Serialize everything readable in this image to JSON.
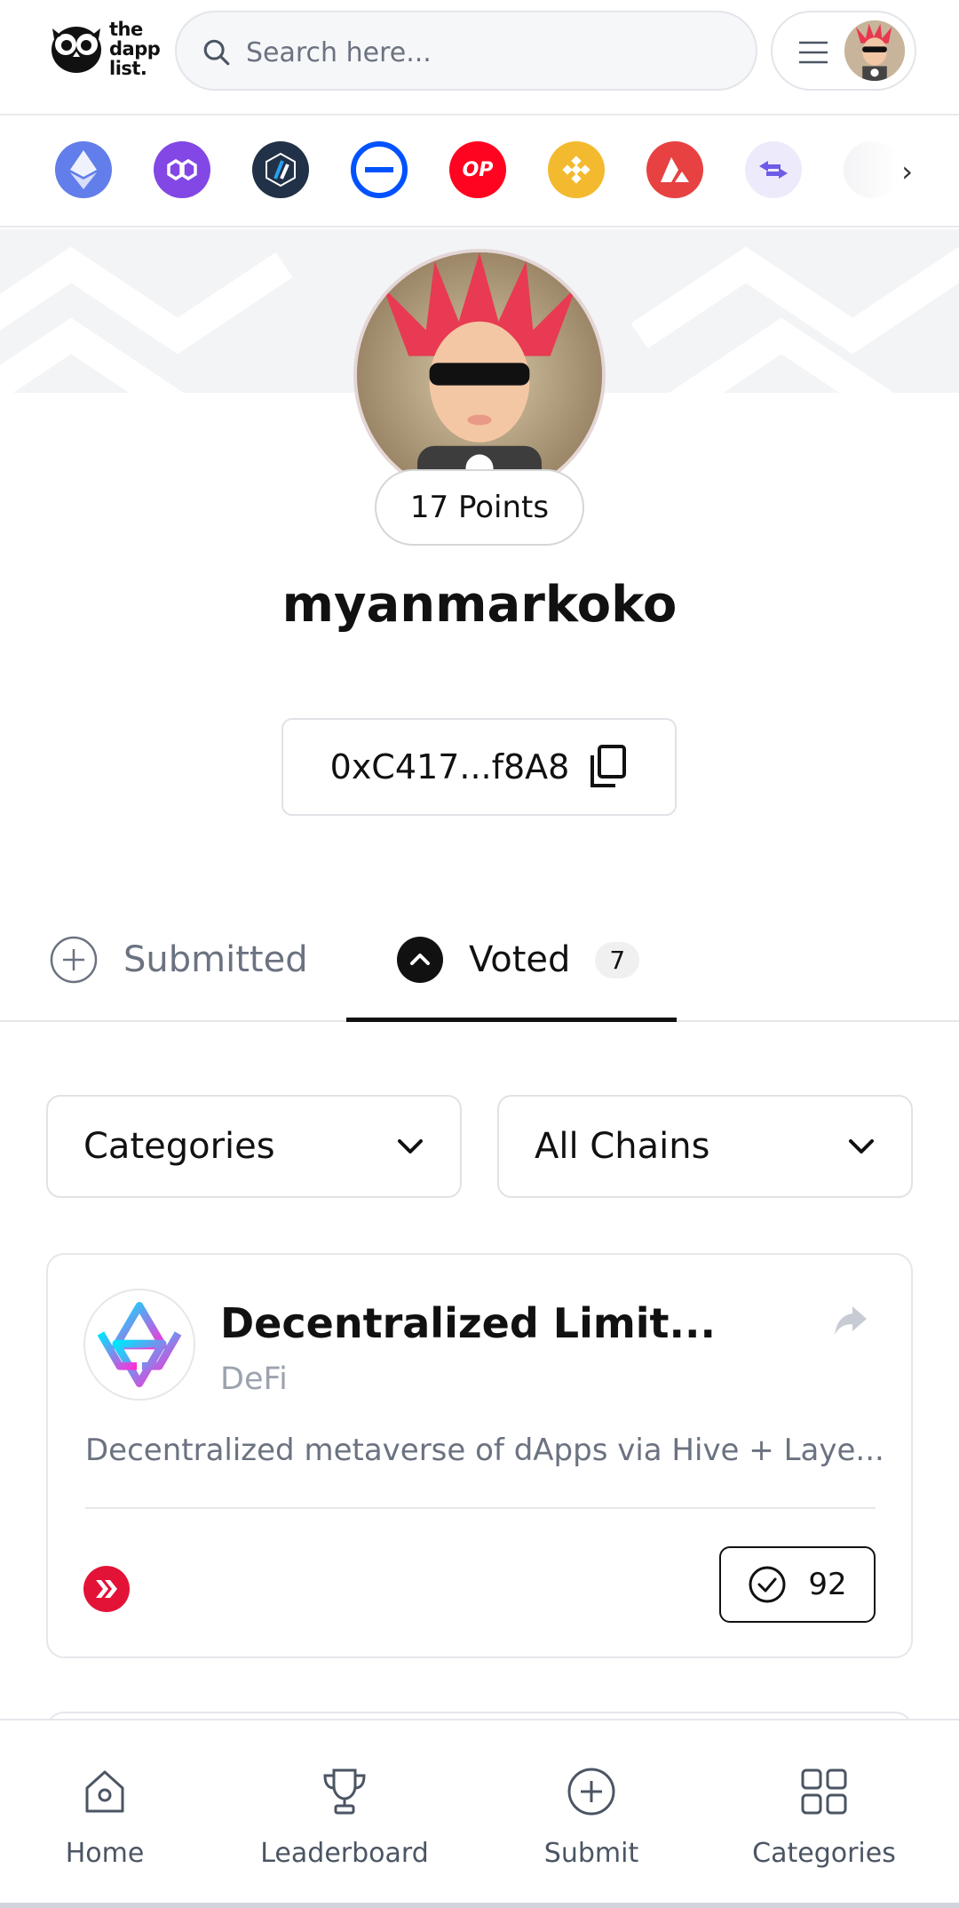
{
  "header": {
    "logo_text": "the\ndapp\nlist.",
    "search_placeholder": "Search here..."
  },
  "chains": [
    {
      "name": "ethereum-chain-icon",
      "color": "#627EEA"
    },
    {
      "name": "polygon-chain-icon",
      "color": "#8247E5"
    },
    {
      "name": "arbitrum-chain-icon",
      "color": "#213147"
    },
    {
      "name": "base-chain-icon",
      "color": "#0052FF"
    },
    {
      "name": "optimism-chain-icon",
      "color": "#FF0420",
      "label": "OP"
    },
    {
      "name": "bnb-chain-icon",
      "color": "#F3BA2F"
    },
    {
      "name": "avalanche-chain-icon",
      "color": "#E84142"
    },
    {
      "name": "bridge-chain-icon",
      "color": "#EDEBFB"
    }
  ],
  "profile": {
    "points": "17 Points",
    "username": "myanmarkoko",
    "address": "0xC417...f8A8"
  },
  "tabs": {
    "submitted": "Submitted",
    "voted": "Voted",
    "voted_count": "7"
  },
  "filters": {
    "categories": "Categories",
    "chains": "All Chains"
  },
  "card": {
    "title": "Decentralized Limit...",
    "category": "DeFi",
    "description": "Decentralized metaverse of dApps via Hive + Laye...",
    "votes": "92"
  },
  "nav": {
    "home": "Home",
    "leaderboard": "Leaderboard",
    "submit": "Submit",
    "categories": "Categories"
  },
  "colors": {
    "accent": "#111111",
    "muted": "#6b7280",
    "hive": "#e31337"
  }
}
